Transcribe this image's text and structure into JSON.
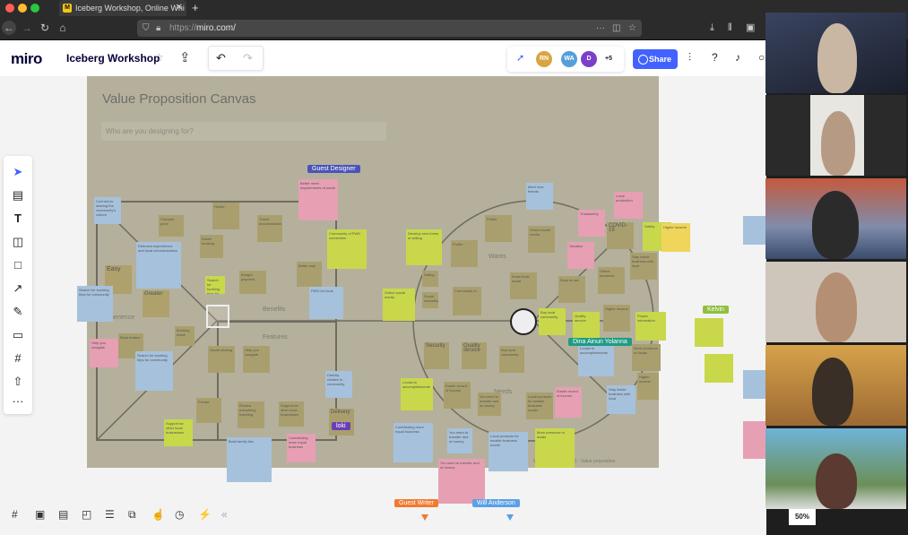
{
  "browser": {
    "tab_title": "Iceberg Workshop, Online Whi",
    "url_proto": "https://",
    "url_host": "miro.com/",
    "new_tab": "+"
  },
  "miro": {
    "logo": "miro",
    "board_name": "Iceberg Workshop",
    "share_label": "Share",
    "collaborators": [
      "RN",
      "WA",
      "D",
      "+5"
    ],
    "zoom": "50%"
  },
  "canvas": {
    "title": "Value Proposition Canvas",
    "designing_placeholder": "Who are you designing for?",
    "labels": {
      "benefits": "Benefits",
      "features": "Features",
      "experience": "Experience",
      "wants": "Wants",
      "needs": "Needs"
    },
    "footer": "Will Van Workshop #1 · Value proposition"
  },
  "cursors": {
    "guest_designer": "Guest Designer",
    "dina": "Dina Ainun Yolanna",
    "kelvin": "Kelvin",
    "loki": "loki",
    "guest_writer": "Guest Writer",
    "will_anderson": "Will Anderson"
  },
  "colors": {
    "accent": "#4262ff",
    "guest_designer": "#4a53b8",
    "dina": "#1f9b84",
    "kelvin": "#8fbf3f",
    "loki": "#6b3fb4",
    "guest_writer": "#f07a30",
    "will_anderson": "#5aa0e6"
  },
  "notes": {
    "n1": "Better meet requirements of social",
    "n2": "Hostel",
    "n3": "Cheaper price",
    "n4": "Travel accomodation",
    "n5": "Easier booking",
    "n6": "Relevant experiences and local communication",
    "n7": "Easy",
    "n8": "Greater",
    "n9": "Community of PWD connection",
    "n10": "PWD for local",
    "n11": "Connect to sharing the community's culture",
    "n12": "Search for booking trips for community",
    "n13": "Better way",
    "n14": "Budget payment",
    "n15": "Book feature",
    "n16": "Booking detail",
    "n17": "Social sharing",
    "n18": "Help you navigate",
    "n19": "Delivery",
    "n20": "Private",
    "n21": "Support for other local businesses",
    "n22": "Review everything traveling",
    "n23": "Directly relative to community",
    "n24": "Develop new forms of selling",
    "n25": "Profile",
    "n26": "Online social media",
    "n27": "Meet new friends",
    "n28": "Dating",
    "n29": "Community to",
    "n30": "Vacation",
    "n31": "Social marketing",
    "n32": "Trustworthy",
    "n33": "Know local social",
    "n34": "Security",
    "n35": "Quality service",
    "n36": "Buy local community",
    "n37": "Locals to accomplishments",
    "n38": "Easier record of income",
    "n39": "Build family ties",
    "n40": "Contributing more equal business",
    "n41": "You need to transfer and of money",
    "n42": "Local products for smaller business model",
    "n43": "More presence to locals",
    "n44": "Local production",
    "n45": "COVID-19",
    "n46": "Safety",
    "n47": "Easy to use",
    "n48": "Online presence",
    "n49": "Higher income",
    "n50": "Stay inside business with local",
    "n51": "Proper information"
  }
}
